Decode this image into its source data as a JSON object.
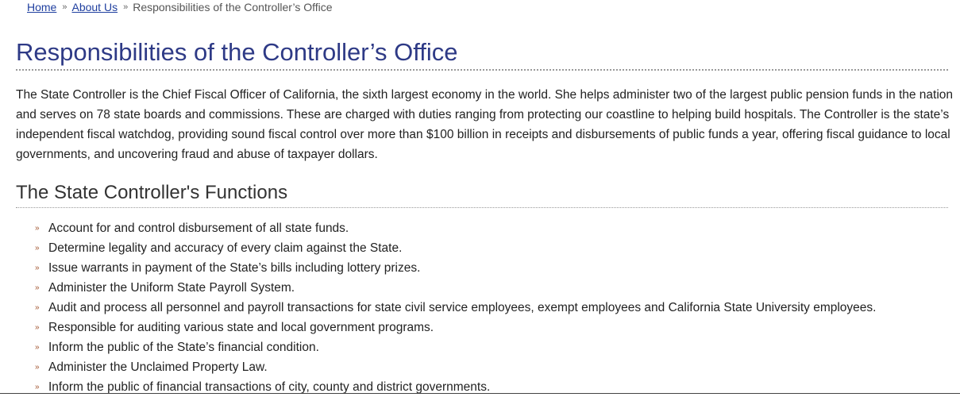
{
  "breadcrumb": {
    "items": [
      {
        "label": "Home",
        "link": true
      },
      {
        "label": "About Us",
        "link": true
      },
      {
        "label": "Responsibilities of the Controller’s Office",
        "link": false
      }
    ],
    "separator": "»"
  },
  "page_title": "Responsibilities of the Controller’s Office",
  "intro": "The State Controller is the Chief Fiscal Officer of California, the sixth largest economy in the world. She helps administer two of the largest public pension funds in the nation and serves on 78 state boards and commissions. These are charged with duties ranging from protecting our coastline to helping build hospitals. The Controller is the state’s independent fiscal watchdog, providing sound fiscal control over more than $100 billion in receipts and disbursements of public funds a year, offering fiscal guidance to local governments, and uncovering fraud and abuse of taxpayer dollars.",
  "section_title": "The State Controller's Functions",
  "functions": [
    "Account for and control disbursement of all state funds.",
    "Determine legality and accuracy of every claim against the State.",
    "Issue warrants in payment of the State’s bills including lottery prizes.",
    "Administer the Uniform State Payroll System.",
    "Audit and process all personnel and payroll transactions for state civil service employees, exempt employees and California State University employees.",
    "Responsible for auditing various state and local government programs.",
    "Inform the public of the State’s financial condition.",
    "Administer the Unclaimed Property Law.",
    "Inform the public of financial transactions of city, county and district governments."
  ],
  "colors": {
    "title": "#2e3a86",
    "link": "#1f3f9f",
    "bullet": "#a0522d"
  },
  "icons": {
    "breadcrumb_separator": "double-chevron-right-icon",
    "list_bullet": "double-chevron-right-icon"
  }
}
